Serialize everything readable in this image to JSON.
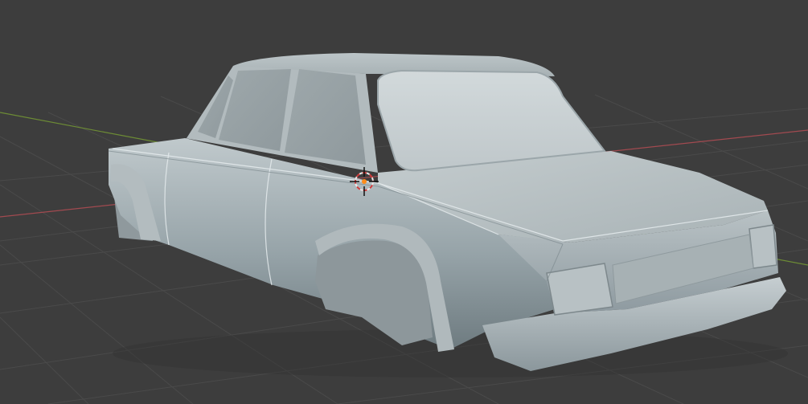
{
  "viewport": {
    "background_color": "#3d3d3d",
    "grid_line_color": "#4a4a4a",
    "x_axis_color": "#a24a50",
    "y_axis_color": "#6d8c35"
  },
  "model": {
    "body_color": "#aeb8bb",
    "shadow_color": "#7f8b90",
    "highlight_color": "#d8dfe1"
  },
  "cursor_3d": {
    "icon": "3d-cursor-icon",
    "ring_color": "#e8e8e8",
    "dash_color": "#d03c3c",
    "center_color": "#ff8c1a"
  }
}
